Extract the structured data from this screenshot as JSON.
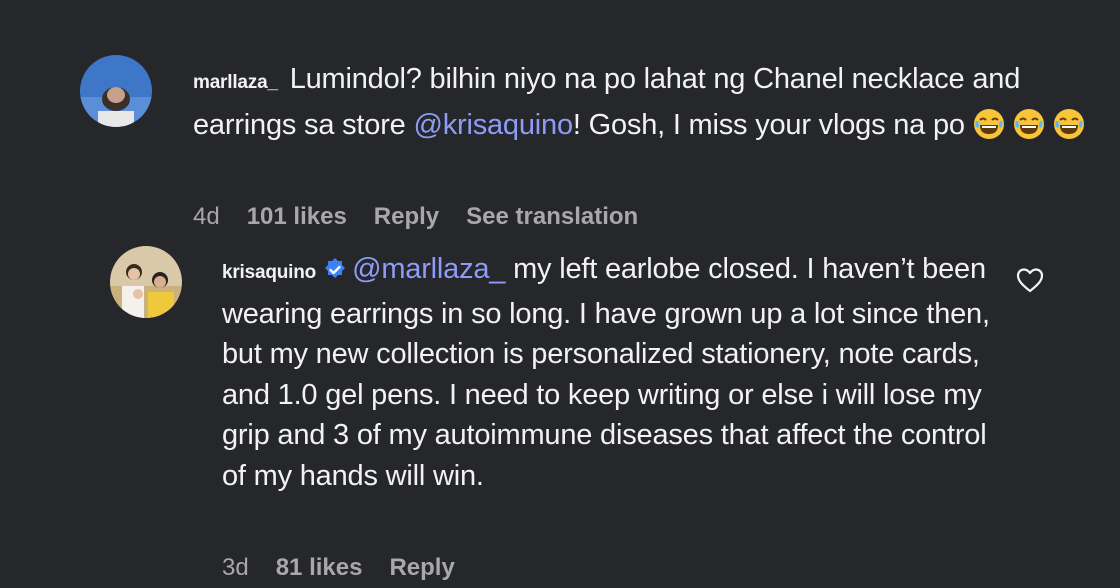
{
  "comment": {
    "username": "marllaza_",
    "text_part1": "Lumindol? bilhin niyo na po lahat ng Chanel necklace and earrings sa store ",
    "mention": "@krisaquino",
    "text_part2": "! Gosh, I miss your vlogs na po ",
    "emoji_name": "face-with-tears-of-joy-icon",
    "time": "4d",
    "likes": "101 likes",
    "reply_label": "Reply",
    "translate_label": "See translation"
  },
  "reply": {
    "username": "krisaquino",
    "mention": "@marllaza_",
    "text": " my left earlobe closed. I haven’t been wearing earrings in so long. I have grown up a lot since then, but my new collection is personalized stationery, note cards, and 1.0 gel pens. I need to keep writing or else i will lose my grip and 3 of my autoimmune diseases that affect the control of my hands will win.",
    "time": "3d",
    "likes": "81 likes",
    "reply_label": "Reply"
  },
  "colors": {
    "background": "#26272b",
    "mention": "#8c9cf7",
    "meta": "#a8a8a8",
    "verified": "#3b82f6"
  }
}
